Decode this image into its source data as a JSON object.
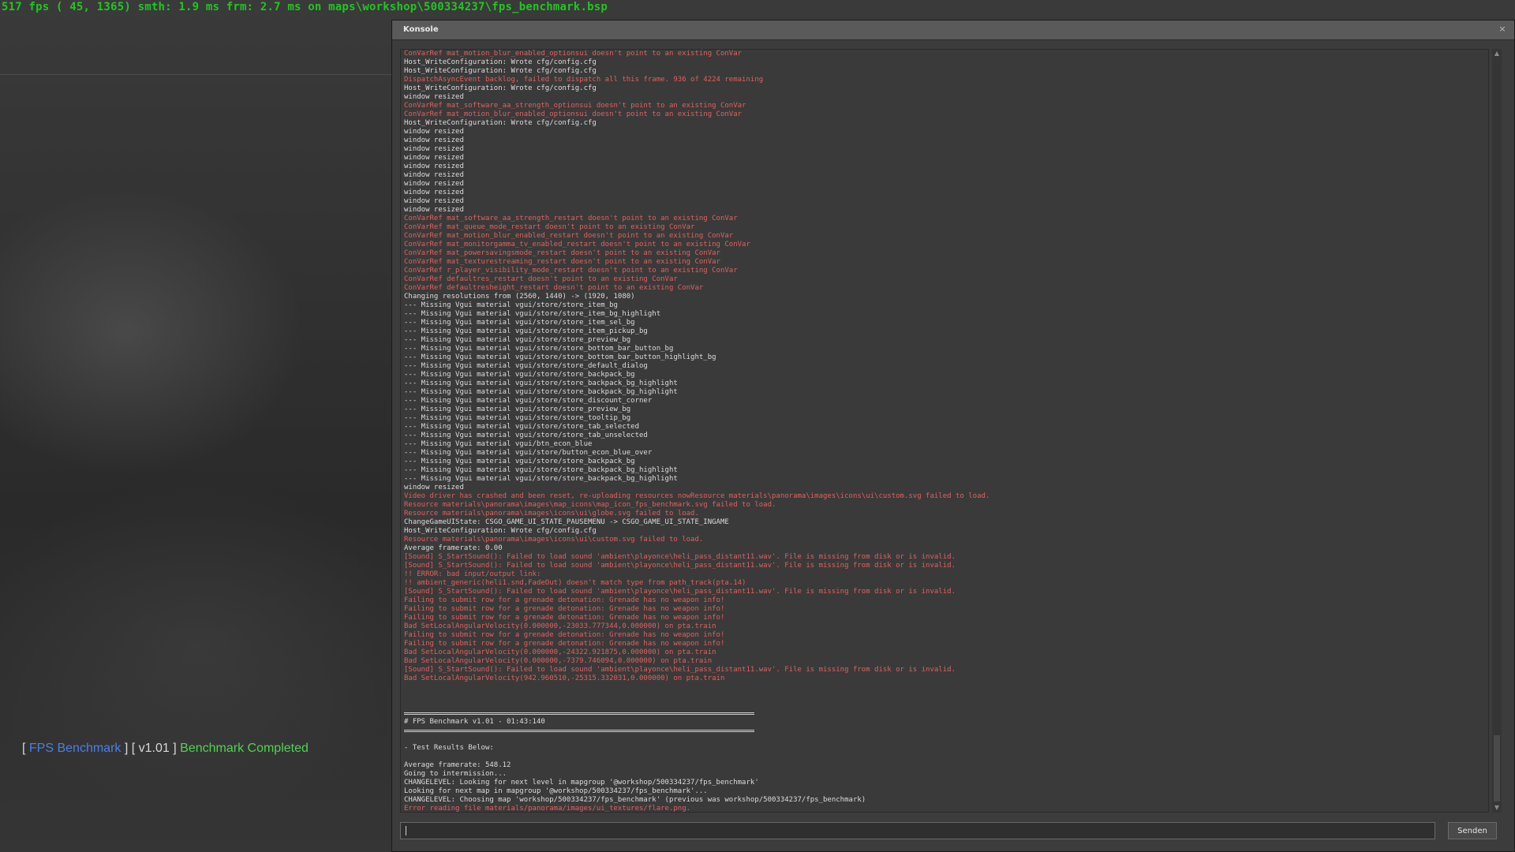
{
  "overlay": {
    "fps_text": "517 fps ( 45, 1365) smth: 1.9 ms frm: 2.7 ms on maps\\workshop\\500334237\\fps_benchmark.bsp"
  },
  "benchmark_message": {
    "open_bracket": "[",
    "name": "FPS Benchmark",
    "mid_bracket": "] [",
    "version": "v1.01",
    "close_bracket": "]",
    "status": "Benchmark Completed"
  },
  "console": {
    "title": "Konsole",
    "close_symbol": "×",
    "submit_label": "Senden",
    "input_value": "",
    "scroll_up": "▲",
    "scroll_down": "▼",
    "lines": [
      {
        "type": "error",
        "text": "ConVarRef mat_motion_blur_enabled_optionsui doesn't point to an existing ConVar"
      },
      {
        "type": "normal",
        "text": "Host_WriteConfiguration: Wrote cfg/config.cfg"
      },
      {
        "type": "normal",
        "text": "Host_WriteConfiguration: Wrote cfg/config.cfg"
      },
      {
        "type": "error",
        "text": "DispatchAsyncEvent backlog, failed to dispatch all this frame. 936 of 4224 remaining"
      },
      {
        "type": "normal",
        "text": "Host_WriteConfiguration: Wrote cfg/config.cfg"
      },
      {
        "type": "normal",
        "text": "window resized"
      },
      {
        "type": "error",
        "text": "ConVarRef mat_software_aa_strength_optionsui doesn't point to an existing ConVar"
      },
      {
        "type": "error",
        "text": "ConVarRef mat_motion_blur_enabled_optionsui doesn't point to an existing ConVar"
      },
      {
        "type": "normal",
        "text": "Host_WriteConfiguration: Wrote cfg/config.cfg"
      },
      {
        "type": "normal",
        "text": "window resized"
      },
      {
        "type": "normal",
        "text": "window resized"
      },
      {
        "type": "normal",
        "text": "window resized"
      },
      {
        "type": "normal",
        "text": "window resized"
      },
      {
        "type": "normal",
        "text": "window resized"
      },
      {
        "type": "normal",
        "text": "window resized"
      },
      {
        "type": "normal",
        "text": "window resized"
      },
      {
        "type": "normal",
        "text": "window resized"
      },
      {
        "type": "normal",
        "text": "window resized"
      },
      {
        "type": "normal",
        "text": "window resized"
      },
      {
        "type": "error",
        "text": "ConVarRef mat_software_aa_strength_restart doesn't point to an existing ConVar"
      },
      {
        "type": "error",
        "text": "ConVarRef mat_queue_mode_restart doesn't point to an existing ConVar"
      },
      {
        "type": "error",
        "text": "ConVarRef mat_motion_blur_enabled_restart doesn't point to an existing ConVar"
      },
      {
        "type": "error",
        "text": "ConVarRef mat_monitorgamma_tv_enabled_restart doesn't point to an existing ConVar"
      },
      {
        "type": "error",
        "text": "ConVarRef mat_powersavingsmode_restart doesn't point to an existing ConVar"
      },
      {
        "type": "error",
        "text": "ConVarRef mat_texturestreaming_restart doesn't point to an existing ConVar"
      },
      {
        "type": "error",
        "text": "ConVarRef r_player_visibility_mode_restart doesn't point to an existing ConVar"
      },
      {
        "type": "error",
        "text": "ConVarRef defaultres_restart doesn't point to an existing ConVar"
      },
      {
        "type": "error",
        "text": "ConVarRef defaultresheight_restart doesn't point to an existing ConVar"
      },
      {
        "type": "normal",
        "text": "Changing resolutions from (2560, 1440) -> (1920, 1080)"
      },
      {
        "type": "normal",
        "text": "--- Missing Vgui material vgui/store/store_item_bg"
      },
      {
        "type": "normal",
        "text": "--- Missing Vgui material vgui/store/store_item_bg_highlight"
      },
      {
        "type": "normal",
        "text": "--- Missing Vgui material vgui/store/store_item_sel_bg"
      },
      {
        "type": "normal",
        "text": "--- Missing Vgui material vgui/store/store_item_pickup_bg"
      },
      {
        "type": "normal",
        "text": "--- Missing Vgui material vgui/store/store_preview_bg"
      },
      {
        "type": "normal",
        "text": "--- Missing Vgui material vgui/store/store_bottom_bar_button_bg"
      },
      {
        "type": "normal",
        "text": "--- Missing Vgui material vgui/store/store_bottom_bar_button_highlight_bg"
      },
      {
        "type": "normal",
        "text": "--- Missing Vgui material vgui/store/store_default_dialog"
      },
      {
        "type": "normal",
        "text": "--- Missing Vgui material vgui/store/store_backpack_bg"
      },
      {
        "type": "normal",
        "text": "--- Missing Vgui material vgui/store/store_backpack_bg_highlight"
      },
      {
        "type": "normal",
        "text": "--- Missing Vgui material vgui/store/store_backpack_bg_highlight"
      },
      {
        "type": "normal",
        "text": "--- Missing Vgui material vgui/store/store_discount_corner"
      },
      {
        "type": "normal",
        "text": "--- Missing Vgui material vgui/store/store_preview_bg"
      },
      {
        "type": "normal",
        "text": "--- Missing Vgui material vgui/store/store_tooltip_bg"
      },
      {
        "type": "normal",
        "text": "--- Missing Vgui material vgui/store/store_tab_selected"
      },
      {
        "type": "normal",
        "text": "--- Missing Vgui material vgui/store/store_tab_unselected"
      },
      {
        "type": "normal",
        "text": "--- Missing Vgui material vgui/btn_econ_blue"
      },
      {
        "type": "normal",
        "text": "--- Missing Vgui material vgui/store/button_econ_blue_over"
      },
      {
        "type": "normal",
        "text": "--- Missing Vgui material vgui/store/store_backpack_bg"
      },
      {
        "type": "normal",
        "text": "--- Missing Vgui material vgui/store/store_backpack_bg_highlight"
      },
      {
        "type": "normal",
        "text": "--- Missing Vgui material vgui/store/store_backpack_bg_highlight"
      },
      {
        "type": "normal",
        "text": "window resized"
      },
      {
        "type": "error",
        "text": "Video driver has crashed and been reset, re-uploading resources nowResource materials\\panorama\\images\\icons\\ui\\custom.svg failed to load."
      },
      {
        "type": "error",
        "text": "Resource materials\\panorama\\images\\map_icons\\map_icon_fps_benchmark.svg failed to load."
      },
      {
        "type": "error",
        "text": "Resource materials\\panorama\\images\\icons\\ui\\globe.svg failed to load."
      },
      {
        "type": "normal",
        "text": "ChangeGameUIState: CSGO_GAME_UI_STATE_PAUSEMENU -> CSGO_GAME_UI_STATE_INGAME"
      },
      {
        "type": "normal",
        "text": "Host_WriteConfiguration: Wrote cfg/config.cfg"
      },
      {
        "type": "error",
        "text": "Resource materials\\panorama\\images\\icons\\ui\\custom.svg failed to load."
      },
      {
        "type": "normal",
        "text": "Average framerate: 0.00"
      },
      {
        "type": "error",
        "text": "[Sound] S_StartSound(): Failed to load sound 'ambient\\playonce\\heli_pass_distant11.wav'. File is missing from disk or is invalid."
      },
      {
        "type": "error",
        "text": "[Sound] S_StartSound(): Failed to load sound 'ambient\\playonce\\heli_pass_distant11.wav'. File is missing from disk or is invalid."
      },
      {
        "type": "error",
        "text": "!! ERROR: bad input/output link:"
      },
      {
        "type": "error",
        "text": "!! ambient_generic(heli1.snd,FadeOut) doesn't match type from path_track(pta.14)"
      },
      {
        "type": "error",
        "text": "[Sound] S_StartSound(): Failed to load sound 'ambient\\playonce\\heli_pass_distant11.wav'. File is missing from disk or is invalid."
      },
      {
        "type": "error",
        "text": "Failing to submit row for a grenade detonation: Grenade has no weapon info!"
      },
      {
        "type": "error",
        "text": "Failing to submit row for a grenade detonation: Grenade has no weapon info!"
      },
      {
        "type": "error",
        "text": "Failing to submit row for a grenade detonation: Grenade has no weapon info!"
      },
      {
        "type": "error",
        "text": "Bad SetLocalAngularVelocity(0.000000,-23033.777344,0.000000) on pta.train"
      },
      {
        "type": "error",
        "text": "Failing to submit row for a grenade detonation: Grenade has no weapon info!"
      },
      {
        "type": "error",
        "text": "Failing to submit row for a grenade detonation: Grenade has no weapon info!"
      },
      {
        "type": "error",
        "text": "Bad SetLocalAngularVelocity(0.000000,-24322.921875,0.000000) on pta.train"
      },
      {
        "type": "error",
        "text": "Bad SetLocalAngularVelocity(0.000000,-7379.746094,0.000000) on pta.train"
      },
      {
        "type": "error",
        "text": "[Sound] S_StartSound(): Failed to load sound 'ambient\\playonce\\heli_pass_distant11.wav'. File is missing from disk or is invalid."
      },
      {
        "type": "error",
        "text": "Bad SetLocalAngularVelocity(942.960510,-25315.332031,0.000000) on pta.train"
      },
      {
        "type": "blank",
        "text": ""
      },
      {
        "type": "blank",
        "text": ""
      },
      {
        "type": "blank",
        "text": ""
      },
      {
        "type": "separator",
        "text": ""
      },
      {
        "type": "normal",
        "text": "# FPS Benchmark v1.01 - 01:43:140"
      },
      {
        "type": "separator",
        "text": ""
      },
      {
        "type": "blank",
        "text": ""
      },
      {
        "type": "normal",
        "text": "- Test Results Below:"
      },
      {
        "type": "blank",
        "text": ""
      },
      {
        "type": "normal",
        "text": "Average framerate: 548.12"
      },
      {
        "type": "normal",
        "text": "Going to intermission..."
      },
      {
        "type": "normal",
        "text": "CHANGELEVEL: Looking for next level in mapgroup '@workshop/500334237/fps_benchmark'"
      },
      {
        "type": "normal",
        "text": "Looking for next map in mapgroup '@workshop/500334237/fps_benchmark'..."
      },
      {
        "type": "normal",
        "text": "CHANGELEVEL: Choosing map 'workshop/500334237/fps_benchmark' (previous was workshop/500334237/fps_benchmark)"
      },
      {
        "type": "error",
        "text": "Error reading file materials/panorama/images/ui_textures/flare.png."
      }
    ]
  }
}
